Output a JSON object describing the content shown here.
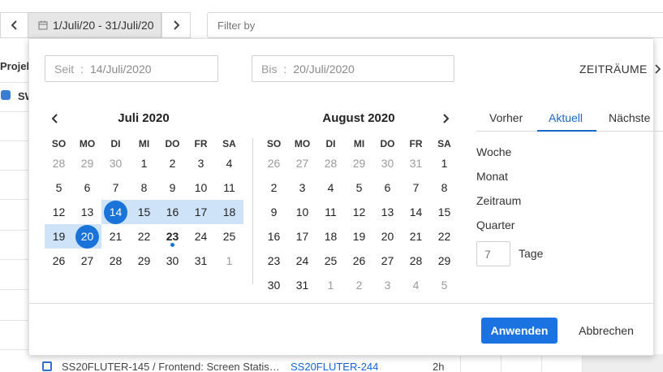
{
  "toolbar": {
    "date_range_label": "1/Juli/20 - 31/Juli/20",
    "filter_placeholder": "Filter by",
    "calendar_icon": "calendar-icon",
    "prev_icon": "chevron-left-icon",
    "next_icon": "chevron-right-icon"
  },
  "background": {
    "column_label": "Projek",
    "row_label": "SW",
    "task_text": "SS20FLUTER-145 / Frontend: Screen Statis…",
    "task_link": "SS20FLUTER-244",
    "task_hours": "2h"
  },
  "popup": {
    "from_label": "Seit",
    "from_value": "14/Juli/2020",
    "to_label": "Bis",
    "to_value": "20/Juli/2020",
    "periods_label": "ZEITRÄUME",
    "weekdays": [
      "SO",
      "MO",
      "DI",
      "MI",
      "DO",
      "FR",
      "SA"
    ],
    "months": [
      {
        "title": "Juli 2020",
        "weeks": [
          [
            "28",
            "29",
            "30",
            "1",
            "2",
            "3",
            "4"
          ],
          [
            "5",
            "6",
            "7",
            "8",
            "9",
            "10",
            "11"
          ],
          [
            "12",
            "13",
            "14",
            "15",
            "16",
            "17",
            "18"
          ],
          [
            "19",
            "20",
            "21",
            "22",
            "23",
            "24",
            "25"
          ],
          [
            "26",
            "27",
            "28",
            "29",
            "30",
            "31",
            "1"
          ]
        ],
        "muted": [
          [
            0,
            0
          ],
          [
            0,
            1
          ],
          [
            0,
            2
          ],
          [
            4,
            6
          ]
        ],
        "range": [
          [
            2,
            2
          ],
          [
            2,
            3
          ],
          [
            2,
            4
          ],
          [
            2,
            5
          ],
          [
            2,
            6
          ],
          [
            3,
            0
          ],
          [
            3,
            1
          ]
        ],
        "selected": [
          [
            2,
            2
          ],
          [
            3,
            1
          ]
        ],
        "today": [
          3,
          4
        ]
      },
      {
        "title": "August 2020",
        "weeks": [
          [
            "26",
            "27",
            "28",
            "29",
            "30",
            "31",
            "1"
          ],
          [
            "2",
            "3",
            "4",
            "5",
            "6",
            "7",
            "8"
          ],
          [
            "9",
            "10",
            "11",
            "12",
            "13",
            "14",
            "15"
          ],
          [
            "16",
            "17",
            "18",
            "19",
            "20",
            "21",
            "22"
          ],
          [
            "23",
            "24",
            "25",
            "26",
            "27",
            "28",
            "29"
          ],
          [
            "30",
            "31",
            "1",
            "2",
            "3",
            "4",
            "5"
          ]
        ],
        "muted": [
          [
            0,
            0
          ],
          [
            0,
            1
          ],
          [
            0,
            2
          ],
          [
            0,
            3
          ],
          [
            0,
            4
          ],
          [
            0,
            5
          ],
          [
            5,
            2
          ],
          [
            5,
            3
          ],
          [
            5,
            4
          ],
          [
            5,
            5
          ],
          [
            5,
            6
          ]
        ],
        "range": [],
        "selected": [],
        "today": null
      }
    ],
    "tabs": [
      "Vorher",
      "Aktuell",
      "Nächste"
    ],
    "active_tab": "Aktuell",
    "quick_ranges": [
      "Woche",
      "Monat",
      "Zeitraum",
      "Quarter"
    ],
    "days_placeholder": "7",
    "days_label": "Tage",
    "apply_label": "Anwenden",
    "cancel_label": "Abbrechen",
    "accent_color": "#1a73e0",
    "range_color": "#cfe3f8"
  }
}
